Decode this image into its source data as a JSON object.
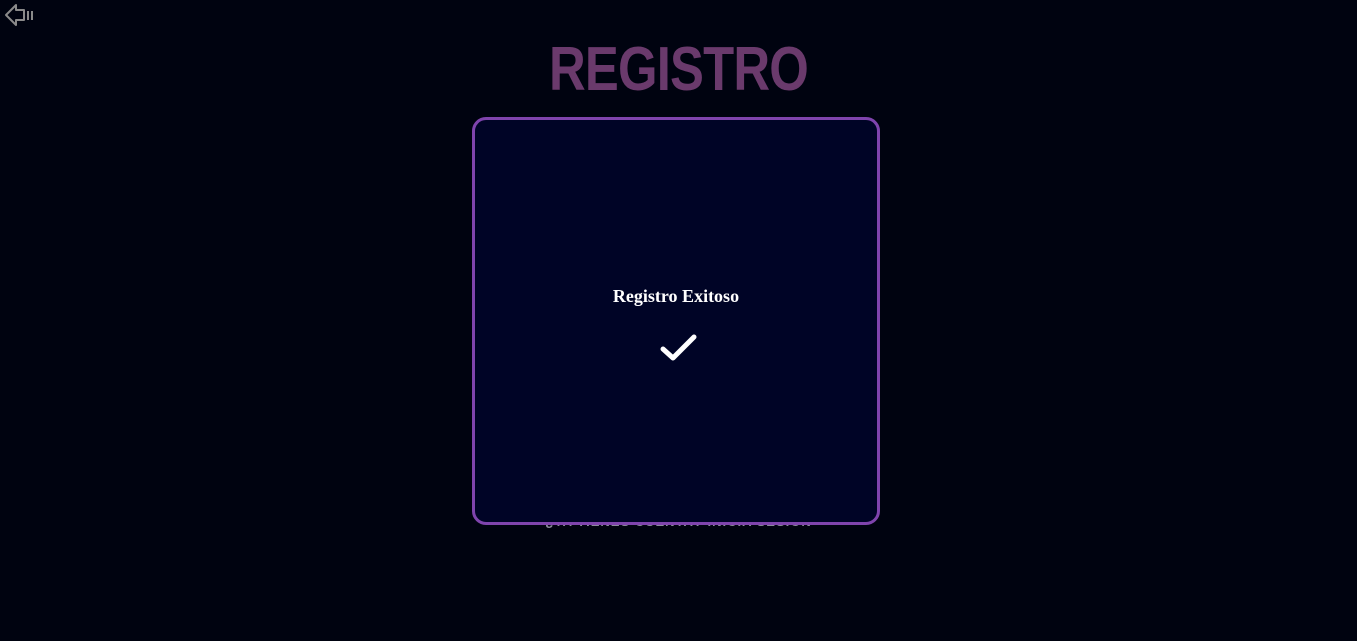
{
  "header": {
    "back_icon": "arrow-left-icon",
    "title": "REGISTRO"
  },
  "footer": {
    "login_link": "¿YA TIENES CUENTA? INICIA SESIÓN"
  },
  "modal": {
    "message": "Registro Exitoso",
    "icon": "check-icon",
    "border_color": "#7f44ad"
  }
}
